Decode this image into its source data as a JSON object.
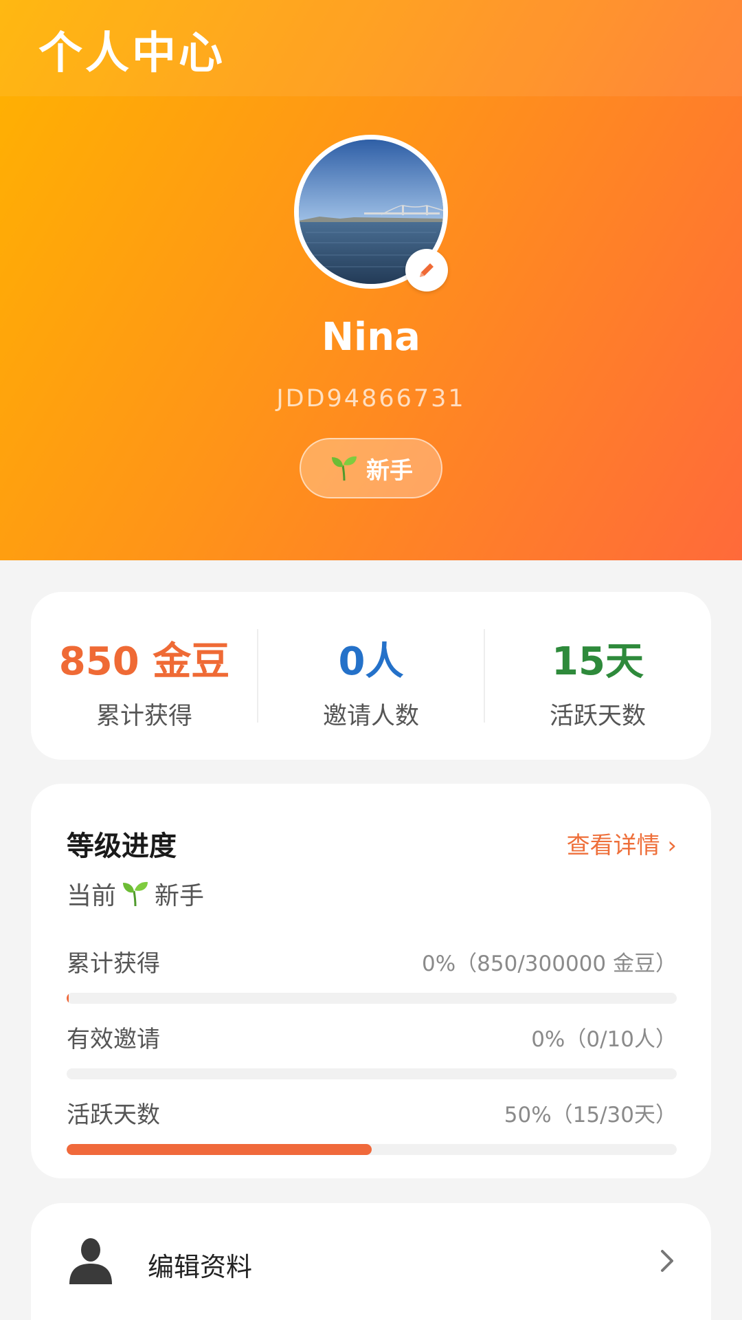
{
  "header": {
    "title": "个人中心",
    "avatar_icon": "avatar-photo",
    "edit_icon": "pencil-icon",
    "user_name": "Nina",
    "user_id": "JDD94866731",
    "level_icon": "seedling-icon",
    "level_label": "新手"
  },
  "stats": [
    {
      "value": "850 金豆",
      "label": "累计获得",
      "color": "#ef6a35"
    },
    {
      "value": "0人",
      "label": "邀请人数",
      "color": "#2471c9"
    },
    {
      "value": "15天",
      "label": "活跃天数",
      "color": "#2e8a3b"
    }
  ],
  "level_progress": {
    "title": "等级进度",
    "detail_link": "查看详情 ›",
    "current_prefix": "当前",
    "current_level": "新手",
    "items": [
      {
        "label": "累计获得",
        "value": "0%（850/300000 金豆）",
        "progress": 0.003
      },
      {
        "label": "有效邀请",
        "value": "0%（0/10人）",
        "progress": 0
      },
      {
        "label": "活跃天数",
        "value": "50%（15/30天）",
        "progress": 0.5
      }
    ]
  },
  "menu": {
    "items": [
      {
        "icon": "person-icon",
        "label": "编辑资料"
      }
    ]
  },
  "colors": {
    "accent": "#f0693b",
    "header_gradient_start": "#ffb300",
    "header_gradient_end": "#ff6a3a"
  }
}
